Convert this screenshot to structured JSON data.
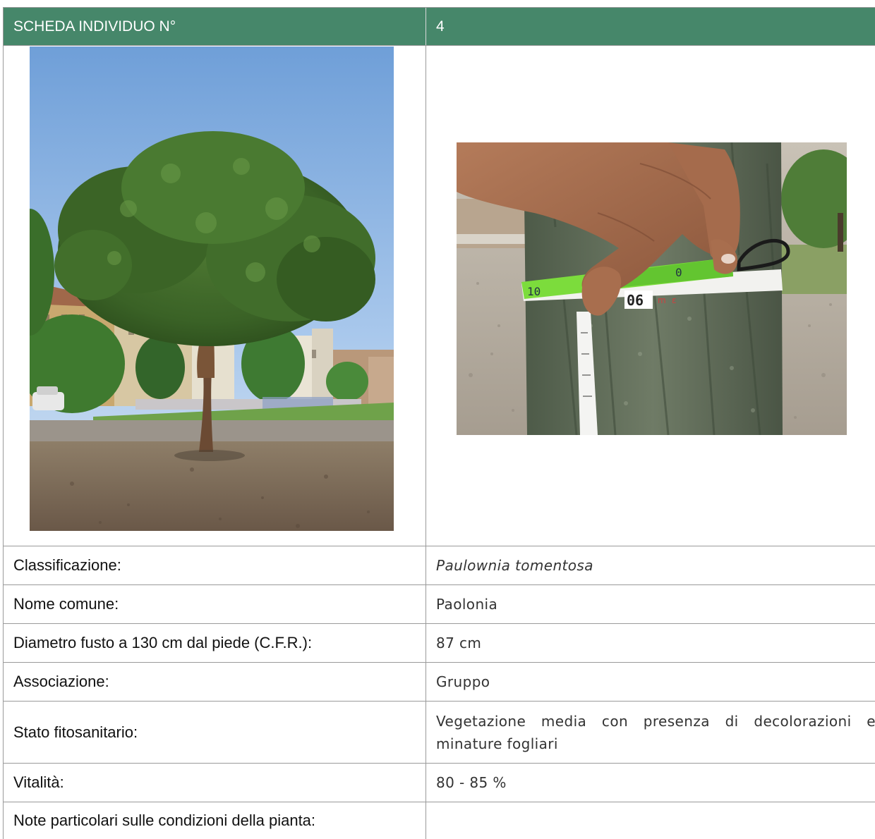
{
  "header": {
    "left_label": "SCHEDA INDIVIDUO N°",
    "number": "4"
  },
  "photos": {
    "tree_photo_icon": "tree-photo-icon",
    "tape_photo_icon": "measuring-tape-photo-icon",
    "tape_markings": [
      "10",
      "0",
      "06",
      "m",
      "ε"
    ]
  },
  "rows": [
    {
      "label": "Classificazione:",
      "value": "Paulownia tomentosa"
    },
    {
      "label": "Nome comune:",
      "value": "Paolonia"
    },
    {
      "label": "Diametro fusto a 130 cm dal piede (C.F.R.):",
      "value": "87 cm"
    },
    {
      "label": "Associazione:",
      "value": "Gruppo"
    },
    {
      "label": "Stato fitosanitario:",
      "value": "Vegetazione media con presenza di decolorazioni e minature fogliari"
    },
    {
      "label": "Vitalità:",
      "value": "80 - 85 %"
    },
    {
      "label": "Note particolari sulle condizioni della pianta:",
      "value": ""
    }
  ],
  "colors": {
    "header_bg": "#46876a",
    "border": "#9a9a9a"
  }
}
